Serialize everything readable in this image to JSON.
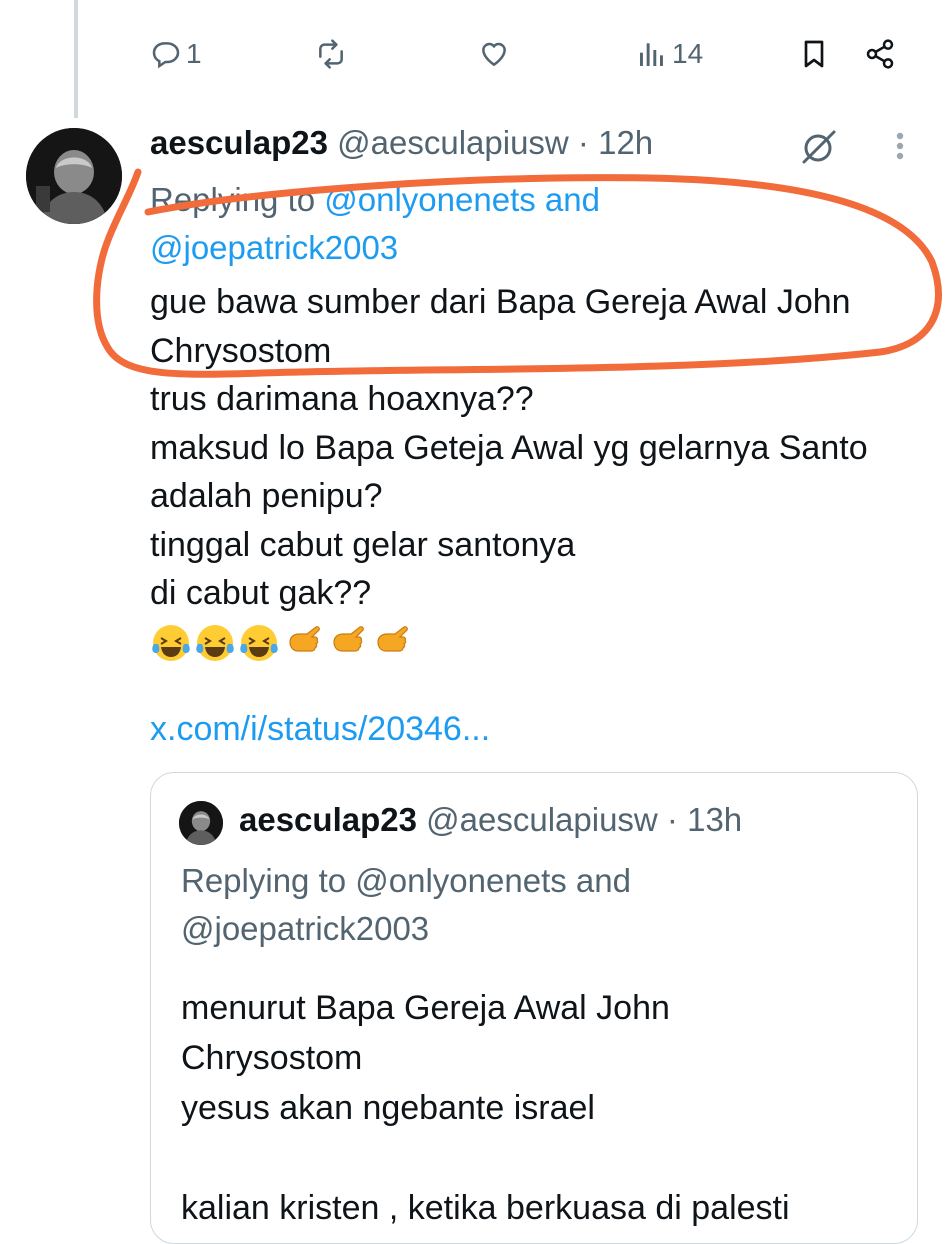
{
  "actions": {
    "reply_count": "1",
    "views_count": "14"
  },
  "tweet": {
    "name": "aesculap23",
    "handle": "@aesculapiusw",
    "separator": " · ",
    "time": "12h",
    "replying_prefix": "Replying to ",
    "replying_user1": "@onlyonenets",
    "replying_and": " and",
    "replying_user2": "@joepatrick2003",
    "lines": [
      "gue bawa sumber dari Bapa Gereja Awal John",
      "Chrysostom",
      "trus darimana hoaxnya??",
      "maksud lo Bapa Geteja Awal yg gelarnya Santo",
      "adalah penipu?",
      "tinggal cabut gelar santonya",
      "di cabut gak??"
    ],
    "emojis": [
      "😂",
      "😂",
      "😂",
      "👉",
      "👉",
      "👉"
    ],
    "link": "x.com/i/status/20346..."
  },
  "quoted": {
    "name": "aesculap23",
    "handle": "@aesculapiusw",
    "separator": " · ",
    "time": "13h",
    "replying_line1": "Replying to @onlyonenets and",
    "replying_line2": "@joepatrick2003",
    "lines": [
      "menurut Bapa Gereja Awal John",
      "Chrysostom",
      "yesus akan ngebante israel",
      "",
      "kalian kristen , ketika berkuasa di palesti"
    ]
  },
  "colors": {
    "accent": "#1d9bf0",
    "secondary_text": "#536471",
    "annotation": "#f26b3a",
    "border": "#cfd9de"
  },
  "icons": [
    "reply-icon",
    "repost-icon",
    "like-icon",
    "views-icon",
    "bookmark-icon",
    "share-icon",
    "grok-icon",
    "more-icon"
  ]
}
